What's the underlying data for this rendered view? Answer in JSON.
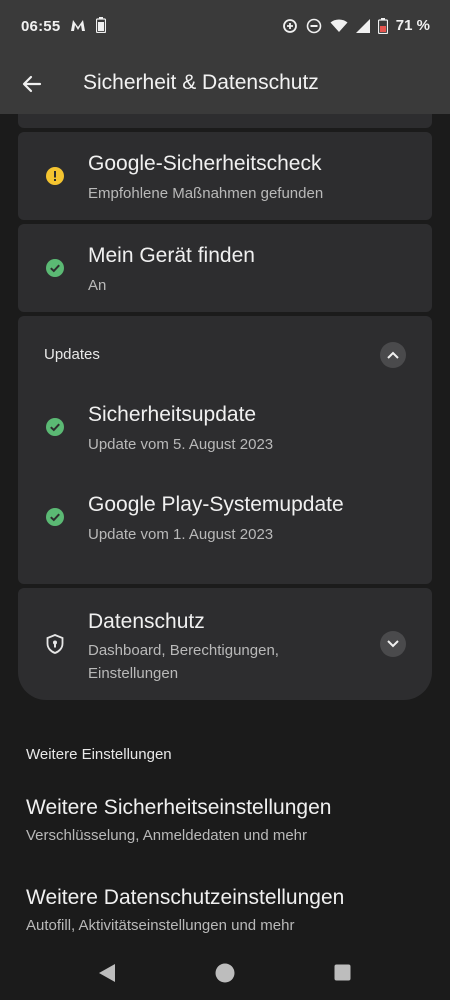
{
  "status_bar": {
    "time": "06:55",
    "battery_percent": "71 %",
    "left_icons": [
      "m-notification-icon",
      "battery-saver-icon"
    ],
    "right_icons": [
      "data-saver-icon",
      "do-not-disturb-icon",
      "wifi-icon",
      "signal-icon",
      "battery-icon"
    ]
  },
  "app_bar": {
    "title": "Sicherheit & Datenschutz",
    "back_icon": "back-arrow-icon"
  },
  "security_items": [
    {
      "title": "Google-Sicherheitscheck",
      "subtitle": "Empfohlene Maßnahmen gefunden",
      "icon": "warning-icon",
      "status_color": "#f4c430"
    },
    {
      "title": "Mein Gerät finden",
      "subtitle": "An",
      "icon": "check-circle-icon",
      "status_color": "#5bb974"
    }
  ],
  "updates": {
    "header": "Updates",
    "expanded": true,
    "items": [
      {
        "title": "Sicherheitsupdate",
        "subtitle": "Update vom 5. August 2023",
        "icon": "check-circle-icon"
      },
      {
        "title": "Google Play-Systemupdate",
        "subtitle": "Update vom 1. August 2023",
        "icon": "check-circle-icon"
      }
    ]
  },
  "privacy": {
    "title": "Datenschutz",
    "subtitle_line1": "Dashboard, Berechtigungen,",
    "subtitle_line2": "Einstellungen",
    "icon": "shield-lock-icon",
    "expanded": false
  },
  "more_settings": {
    "header": "Weitere Einstellungen",
    "items": [
      {
        "title": "Weitere Sicherheitseinstellungen",
        "subtitle": "Verschlüsselung, Anmeldedaten und mehr"
      },
      {
        "title": "Weitere Datenschutzeinstellungen",
        "subtitle": "Autofill, Aktivitätseinstellungen und mehr"
      }
    ]
  },
  "nav_bar": {
    "buttons": [
      "back-triangle-icon",
      "home-circle-icon",
      "recents-square-icon"
    ]
  },
  "colors": {
    "background": "#1b1b1b",
    "card": "#2d2d2f",
    "bar": "#3a3a3a",
    "success": "#5bb974",
    "warning": "#f4c430",
    "battery_low": "#e5554f"
  }
}
